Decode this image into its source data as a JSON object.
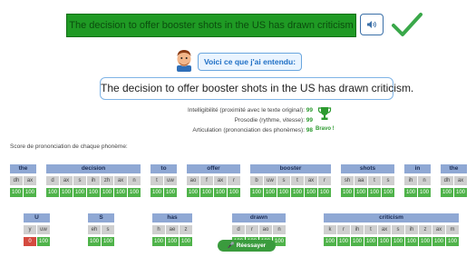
{
  "target": {
    "sentence": "The decision to offer booster shots in the US has drawn criticism",
    "speaker_icon": "speaker-icon",
    "status_icon": "checkmark-icon",
    "colors": {
      "bar": "#1f9a24",
      "check": "#3aa84a"
    }
  },
  "heard": {
    "button_label": "Voici ce que j'ai entendu:",
    "text": "The decision to offer booster shots in the US has drawn criticism."
  },
  "metrics": [
    {
      "label": "Intelligibilité (proximité avec le texte original):",
      "value": "99"
    },
    {
      "label": "Prosodie (rythme, vitesse):",
      "value": "99"
    },
    {
      "label": "Articulation (prononciation des phonèmes):",
      "value": "98"
    }
  ],
  "award": {
    "icon": "trophy-icon",
    "label": "Bravo !"
  },
  "score_title": "Score de prononciation de chaque phonème:",
  "rows": [
    {
      "words": [
        {
          "word": "the",
          "phonemes": [
            {
              "p": "dh",
              "s": "100"
            },
            {
              "p": "ax",
              "s": "100"
            }
          ]
        },
        {
          "word": "decision",
          "phonemes": [
            {
              "p": "d",
              "s": "100"
            },
            {
              "p": "ax",
              "s": "100"
            },
            {
              "p": "s",
              "s": "100"
            },
            {
              "p": "ih",
              "s": "100"
            },
            {
              "p": "zh",
              "s": "100"
            },
            {
              "p": "ax",
              "s": "100"
            },
            {
              "p": "n",
              "s": "100"
            }
          ]
        },
        {
          "word": "to",
          "phonemes": [
            {
              "p": "t",
              "s": "100"
            },
            {
              "p": "uw",
              "s": "100"
            }
          ]
        },
        {
          "word": "offer",
          "phonemes": [
            {
              "p": "ao",
              "s": "100"
            },
            {
              "p": "f",
              "s": "100"
            },
            {
              "p": "ax",
              "s": "100"
            },
            {
              "p": "r",
              "s": "100"
            }
          ]
        },
        {
          "word": "booster",
          "phonemes": [
            {
              "p": "b",
              "s": "100"
            },
            {
              "p": "uw",
              "s": "100"
            },
            {
              "p": "s",
              "s": "100"
            },
            {
              "p": "t",
              "s": "100"
            },
            {
              "p": "ax",
              "s": "100"
            },
            {
              "p": "r",
              "s": "100"
            }
          ]
        },
        {
          "word": "shots",
          "phonemes": [
            {
              "p": "sh",
              "s": "100"
            },
            {
              "p": "aa",
              "s": "100"
            },
            {
              "p": "t",
              "s": "100"
            },
            {
              "p": "s",
              "s": "100"
            }
          ]
        },
        {
          "word": "in",
          "phonemes": [
            {
              "p": "ih",
              "s": "100"
            },
            {
              "p": "n",
              "s": "100"
            }
          ]
        },
        {
          "word": "the",
          "phonemes": [
            {
              "p": "dh",
              "s": "100"
            },
            {
              "p": "ax",
              "s": "100"
            }
          ]
        }
      ]
    },
    {
      "words": [
        {
          "word": "U",
          "phonemes": [
            {
              "p": "y",
              "s": "0"
            },
            {
              "p": "uw",
              "s": "100"
            }
          ]
        },
        {
          "word": "S",
          "phonemes": [
            {
              "p": "eh",
              "s": "100"
            },
            {
              "p": "s",
              "s": "100"
            }
          ]
        },
        {
          "word": "has",
          "phonemes": [
            {
              "p": "h",
              "s": "100"
            },
            {
              "p": "ae",
              "s": "100"
            },
            {
              "p": "z",
              "s": "100"
            }
          ]
        },
        {
          "word": "drawn",
          "phonemes": [
            {
              "p": "d",
              "s": "100"
            },
            {
              "p": "r",
              "s": "100"
            },
            {
              "p": "ao",
              "s": "100"
            },
            {
              "p": "n",
              "s": "100"
            }
          ]
        },
        {
          "word": "criticism",
          "phonemes": [
            {
              "p": "k",
              "s": "100"
            },
            {
              "p": "r",
              "s": "100"
            },
            {
              "p": "ih",
              "s": "100"
            },
            {
              "p": "t",
              "s": "100"
            },
            {
              "p": "ax",
              "s": "100"
            },
            {
              "p": "s",
              "s": "100"
            },
            {
              "p": "ih",
              "s": "100"
            },
            {
              "p": "z",
              "s": "100"
            },
            {
              "p": "ax",
              "s": "100"
            },
            {
              "p": "m",
              "s": "100"
            }
          ]
        }
      ]
    }
  ],
  "retry": {
    "icon": "microphone-icon",
    "label": "Réessayer"
  }
}
